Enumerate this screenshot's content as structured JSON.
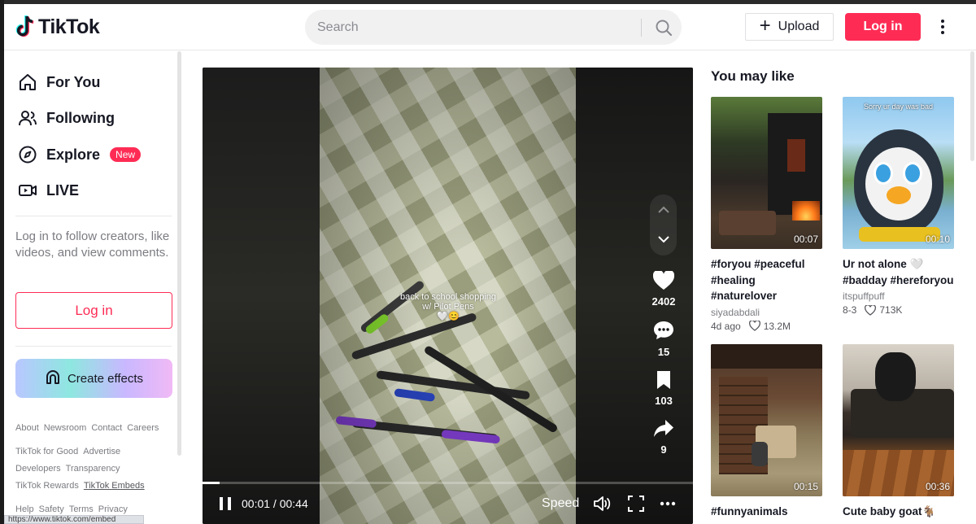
{
  "header": {
    "logo_text": "TikTok",
    "search_placeholder": "Search",
    "upload_label": "Upload",
    "login_label": "Log in"
  },
  "sidebar": {
    "nav": [
      {
        "label": "For You",
        "icon": "home-icon"
      },
      {
        "label": "Following",
        "icon": "following-icon"
      },
      {
        "label": "Explore",
        "icon": "compass-icon",
        "badge": "New"
      },
      {
        "label": "LIVE",
        "icon": "live-icon"
      }
    ],
    "login_hint": "Log in to follow creators, like videos, and view comments.",
    "login_label": "Log in",
    "create_effects_label": "Create effects",
    "footer_rows": [
      [
        "About",
        "Newsroom",
        "Contact",
        "Careers"
      ],
      [
        "TikTok for Good",
        "Advertise"
      ],
      [
        "Developers",
        "Transparency"
      ],
      [
        "TikTok Rewards",
        "TikTok Embeds"
      ],
      [
        "Help",
        "Safety",
        "Terms",
        "Privacy"
      ]
    ],
    "status_url": "https://www.tiktok.com/embed"
  },
  "video": {
    "caption_line1": "back to school shopping",
    "caption_line2": "w/ Pilot Pens",
    "caption_emoji": "🤍😊",
    "likes": "2402",
    "comments": "15",
    "saves": "103",
    "shares": "9",
    "time_display": "00:01 / 00:44",
    "progress_fraction": 0.035,
    "speed_label": "Speed"
  },
  "rail": {
    "title": "You may like",
    "cards": [
      {
        "title": "#foryou #peaceful #healing #naturelover",
        "author": "siyadabdali",
        "age": "4d ago",
        "likes": "13.2M",
        "duration": "00:07",
        "thumb_caption": ""
      },
      {
        "title": "Ur not alone 🤍 #badday #hereforyou",
        "author": "itspuffpuff",
        "age": "8-3",
        "likes": "713K",
        "duration": "00:10",
        "thumb_caption": "Sorry ur day was bad"
      },
      {
        "title": "#funnyanimals",
        "author": "",
        "age": "",
        "likes": "",
        "duration": "00:15",
        "thumb_caption": ""
      },
      {
        "title": "Cute baby goat🐐",
        "author": "",
        "age": "",
        "likes": "",
        "duration": "00:36",
        "thumb_caption": ""
      }
    ]
  },
  "colors": {
    "brand": "#fe2c55",
    "text": "#161823",
    "muted": "#7b7c82"
  }
}
